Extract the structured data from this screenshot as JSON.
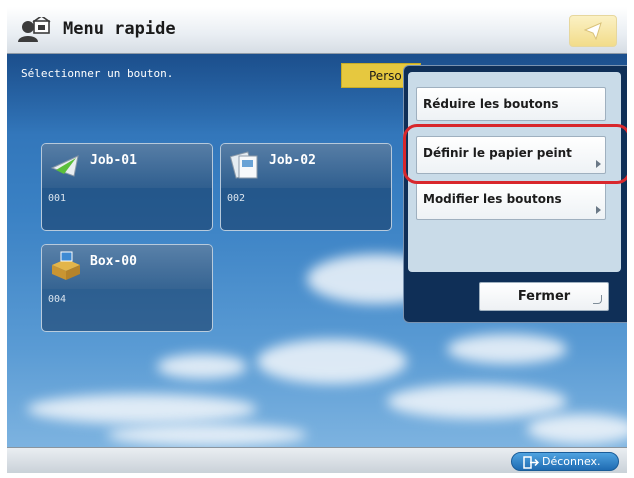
{
  "header": {
    "title": "Menu rapide",
    "icon": "user-home-icon",
    "favorite_icon": "paper-plane-icon"
  },
  "main": {
    "instruction": "Sélectionner un bouton.",
    "tab_label": "Perso",
    "tiles": [
      {
        "name": "Job-01",
        "number": "001",
        "icon": "send-job-icon"
      },
      {
        "name": "Job-02",
        "number": "002",
        "icon": "copy-job-icon"
      },
      {
        "name": "Box-00",
        "number": "004",
        "icon": "mailbox-icon"
      }
    ]
  },
  "popup": {
    "items": [
      {
        "label": "Réduire les boutons"
      },
      {
        "label": "Définir le papier peint"
      },
      {
        "label": "Modifier les boutons"
      }
    ],
    "close_label": "Fermer",
    "highlight_color": "#d8272c"
  },
  "footer": {
    "logout_label": "Déconnex.",
    "logout_icon": "logout-icon"
  },
  "colors": {
    "accent_yellow": "#e6c83f",
    "logout_blue": "#1f6bb2"
  }
}
